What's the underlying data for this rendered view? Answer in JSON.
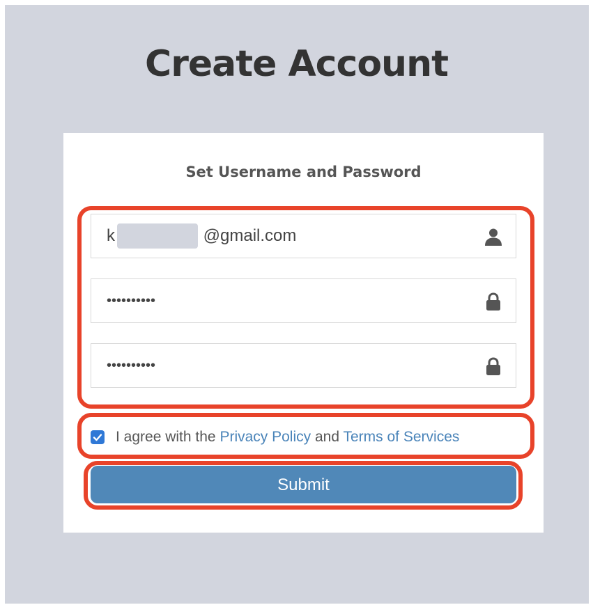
{
  "page": {
    "title": "Create Account",
    "background_color": "#d2d5de"
  },
  "card": {
    "title": "Set Username and Password"
  },
  "form": {
    "email": {
      "value_prefix": "k",
      "value_suffix": "@gmail.com",
      "icon": "user-icon"
    },
    "password": {
      "value": "••••••••••",
      "icon": "lock-icon"
    },
    "confirm_password": {
      "value": "••••••••••",
      "icon": "lock-icon"
    },
    "agree": {
      "checked": true,
      "text_before": "I agree with the",
      "privacy_link": "Privacy Policy",
      "text_between": "and",
      "terms_link": "Terms of Services"
    },
    "submit_label": "Submit"
  },
  "colors": {
    "highlight": "#e8432a",
    "button": "#5088b8",
    "link": "#4a84b9",
    "checkbox": "#2f78d6"
  }
}
